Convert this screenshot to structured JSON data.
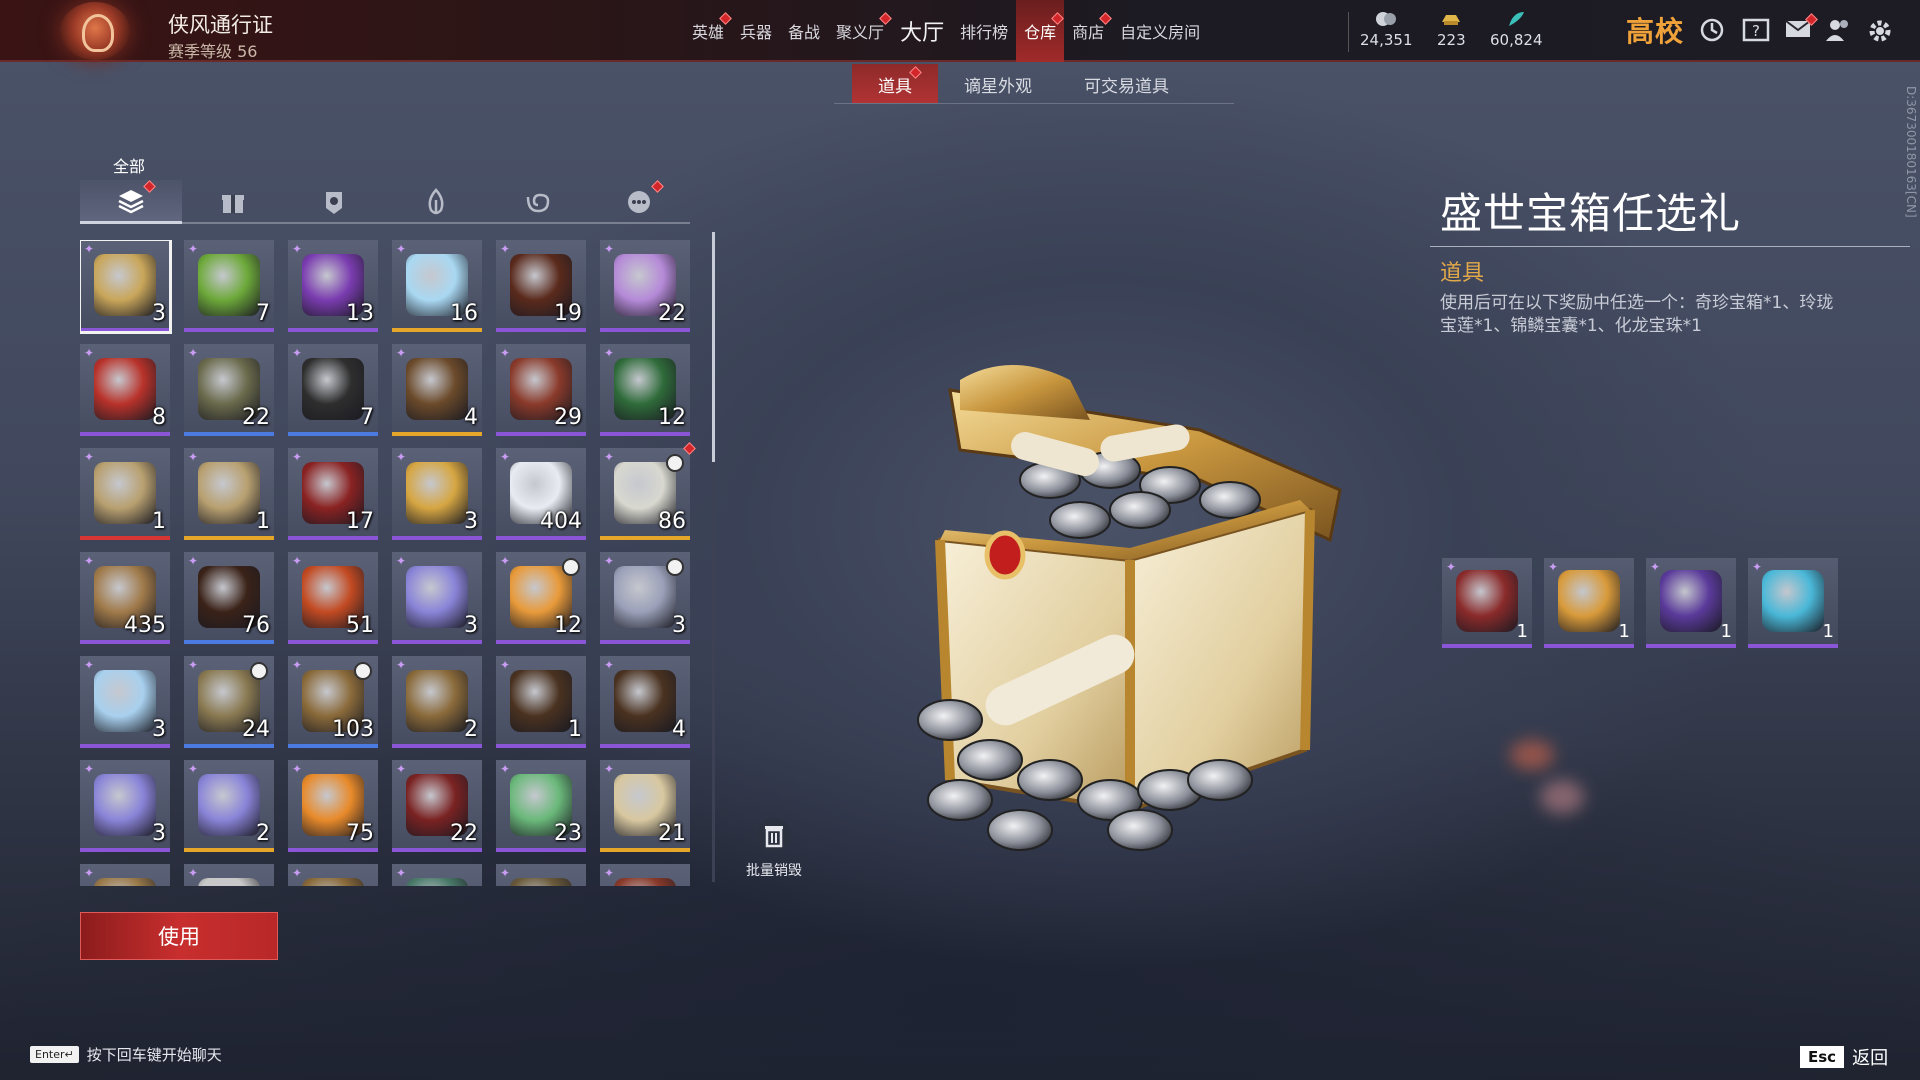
{
  "header": {
    "pass_title": "侠风通行证",
    "pass_level": "赛季等级 56",
    "nav": [
      {
        "label": "英雄",
        "dot": true,
        "big": false,
        "active": false
      },
      {
        "label": "兵器",
        "dot": false,
        "big": false,
        "active": false
      },
      {
        "label": "备战",
        "dot": false,
        "big": false,
        "active": false
      },
      {
        "label": "聚义厅",
        "dot": true,
        "big": false,
        "active": false
      },
      {
        "label": "大厅",
        "dot": false,
        "big": true,
        "active": false
      },
      {
        "label": "排行榜",
        "dot": false,
        "big": false,
        "active": false
      },
      {
        "label": "仓库",
        "dot": true,
        "big": false,
        "active": true
      },
      {
        "label": "商店",
        "dot": true,
        "big": false,
        "active": false
      },
      {
        "label": "自定义房间",
        "dot": false,
        "big": false,
        "active": false
      }
    ],
    "currencies": [
      {
        "icon": "coin-icon",
        "value": "24,351"
      },
      {
        "icon": "gold-ingot-icon",
        "value": "223"
      },
      {
        "icon": "feather-icon",
        "value": "60,824"
      }
    ],
    "brand": "高校"
  },
  "subtabs": [
    {
      "label": "道具",
      "active": true,
      "dot": true
    },
    {
      "label": "谪星外观",
      "active": false,
      "dot": false
    },
    {
      "label": "可交易道具",
      "active": false,
      "dot": false
    }
  ],
  "category": {
    "label": "全部",
    "tabs": [
      {
        "icon": "layers-icon",
        "active": true,
        "dot": true
      },
      {
        "icon": "gift-icon",
        "active": false,
        "dot": false
      },
      {
        "icon": "badge-icon",
        "active": false,
        "dot": false
      },
      {
        "icon": "flame-icon",
        "active": false,
        "dot": false
      },
      {
        "icon": "swirl-icon",
        "active": false,
        "dot": false
      },
      {
        "icon": "more-icon",
        "active": false,
        "dot": true
      }
    ]
  },
  "items": [
    {
      "count": "3",
      "q": "purple",
      "color": "#c9a65a",
      "selected": true
    },
    {
      "count": "7",
      "q": "purple",
      "color": "#6da93a"
    },
    {
      "count": "13",
      "q": "purple",
      "color": "#7a3cb0"
    },
    {
      "count": "16",
      "q": "gold",
      "color": "#a9d8f2"
    },
    {
      "count": "19",
      "q": "purple",
      "color": "#5a2a1c"
    },
    {
      "count": "22",
      "q": "purple",
      "color": "#b58ad8"
    },
    {
      "count": "8",
      "q": "purple",
      "color": "#b8322a"
    },
    {
      "count": "22",
      "q": "blue",
      "color": "#6a6a4c"
    },
    {
      "count": "7",
      "q": "blue",
      "color": "#2e2e2e"
    },
    {
      "count": "4",
      "q": "gold",
      "color": "#6b4a2a"
    },
    {
      "count": "29",
      "q": "purple",
      "color": "#8a3a2a"
    },
    {
      "count": "12",
      "q": "purple",
      "color": "#2f6b3a"
    },
    {
      "count": "1",
      "q": "red",
      "color": "#b8a070"
    },
    {
      "count": "1",
      "q": "gold",
      "color": "#b8a070"
    },
    {
      "count": "17",
      "q": "purple",
      "color": "#8a2222"
    },
    {
      "count": "3",
      "q": "purple",
      "color": "#d6a642"
    },
    {
      "count": "404",
      "q": "purple",
      "color": "#e8ecf2"
    },
    {
      "count": "86",
      "q": "gold",
      "color": "#d8d8d0",
      "clock": true,
      "dot": true
    },
    {
      "count": "435",
      "q": "purple",
      "color": "#a07a4a"
    },
    {
      "count": "76",
      "q": "blue",
      "color": "#3a2218"
    },
    {
      "count": "51",
      "q": "purple",
      "color": "#c24a22"
    },
    {
      "count": "3",
      "q": "purple",
      "color": "#8a84d8"
    },
    {
      "count": "12",
      "q": "purple",
      "color": "#e89a3a",
      "clock": true
    },
    {
      "count": "3",
      "q": "purple",
      "color": "#9aa0b8",
      "clock": true
    },
    {
      "count": "3",
      "q": "purple",
      "color": "#a8d0ee"
    },
    {
      "count": "24",
      "q": "blue",
      "color": "#8a7a52",
      "clock": true
    },
    {
      "count": "103",
      "q": "blue",
      "color": "#8a6a3a",
      "clock": true
    },
    {
      "count": "2",
      "q": "purple",
      "color": "#8a6a3a"
    },
    {
      "count": "1",
      "q": "purple",
      "color": "#4a3220"
    },
    {
      "count": "4",
      "q": "purple",
      "color": "#4a3220"
    },
    {
      "count": "3",
      "q": "purple",
      "color": "#8a84d8"
    },
    {
      "count": "2",
      "q": "gold",
      "color": "#8a84d8"
    },
    {
      "count": "75",
      "q": "purple",
      "color": "#e88a2a"
    },
    {
      "count": "22",
      "q": "purple",
      "color": "#7a2222"
    },
    {
      "count": "23",
      "q": "purple",
      "color": "#6ab87a"
    },
    {
      "count": "21",
      "q": "gold",
      "color": "#d8c8a0"
    },
    {
      "count": "",
      "q": "gold",
      "color": "#9a7a4a"
    },
    {
      "count": "",
      "q": "blue",
      "color": "#c8c8c8"
    },
    {
      "count": "",
      "q": "blue",
      "color": "#8a6a3a"
    },
    {
      "count": "",
      "q": "purple",
      "color": "#4a7a6a"
    },
    {
      "count": "",
      "q": "gold",
      "color": "#6a5a3a"
    },
    {
      "count": "",
      "q": "gold",
      "color": "#8a3a2a"
    }
  ],
  "bulk_destroy": "批量销毁",
  "use_button": "使用",
  "detail": {
    "title": "盛世宝箱任选礼",
    "type": "道具",
    "description": "使用后可在以下奖励中任选一个：奇珍宝箱*1、玲珑宝莲*1、锦鳞宝囊*1、化龙宝珠*1",
    "side_code": "D:3673001801​63[CN]",
    "rewards": [
      {
        "count": "1",
        "color": "#8a2a2a"
      },
      {
        "count": "1",
        "color": "#d89a3a"
      },
      {
        "count": "1",
        "color": "#5a3a9a"
      },
      {
        "count": "1",
        "color": "#4ab8d8"
      }
    ]
  },
  "footer": {
    "enter_key": "Enter↵",
    "enter_hint": "按下回车键开始聊天",
    "esc_key": "Esc",
    "esc_hint": "返回"
  }
}
